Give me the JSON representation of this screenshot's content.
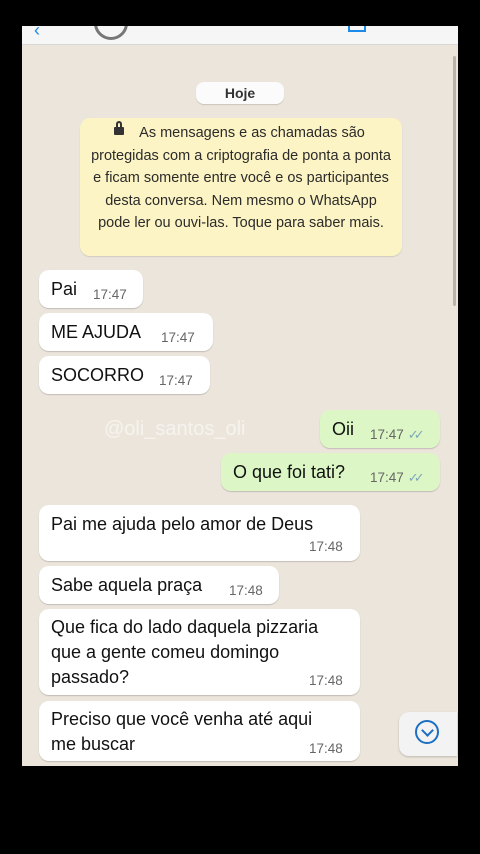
{
  "chat": {
    "date_separator": "Hoje",
    "encryption_notice": "As mensagens e as chamadas são protegidas com a criptografia de ponta a ponta e ficam somente entre você e os participantes desta conversa. Nem mesmo o WhatsApp pode ler ou ouvi-las. Toque para saber mais.",
    "watermark": "@oli_santos_oli",
    "messages": [
      {
        "direction": "incoming",
        "text": "Pai",
        "time": "17:47"
      },
      {
        "direction": "incoming",
        "text": "ME AJUDA",
        "time": "17:47"
      },
      {
        "direction": "incoming",
        "text": "SOCORRO",
        "time": "17:47"
      },
      {
        "direction": "outgoing",
        "text": "Oii",
        "time": "17:47",
        "status": "read"
      },
      {
        "direction": "outgoing",
        "text": "O que foi tati?",
        "time": "17:47",
        "status": "read"
      },
      {
        "direction": "incoming",
        "text": "Pai me ajuda pelo amor de Deus",
        "time": "17:48"
      },
      {
        "direction": "incoming",
        "text": "Sabe aquela praça",
        "time": "17:48"
      },
      {
        "direction": "incoming",
        "lines": [
          "Que fica do lado daquela pizzaria",
          "que a gente comeu domingo",
          "passado?"
        ],
        "time": "17:48"
      },
      {
        "direction": "incoming",
        "lines": [
          "Preciso que você venha até aqui",
          "me buscar"
        ],
        "time": "17:48"
      }
    ]
  },
  "icons": {
    "lock": "lock-icon",
    "read_ticks": "double-check-icon",
    "scroll_down": "chevron-down-circle-icon",
    "back": "back-arrow-icon"
  },
  "colors": {
    "chat_background": "#ece5dc",
    "incoming_bubble": "#ffffff",
    "outgoing_bubble": "#dcf7c5",
    "encryption_banner": "#fcf4c4",
    "read_ticks": "#7fa7b6",
    "accent": "#1c6fc2"
  }
}
